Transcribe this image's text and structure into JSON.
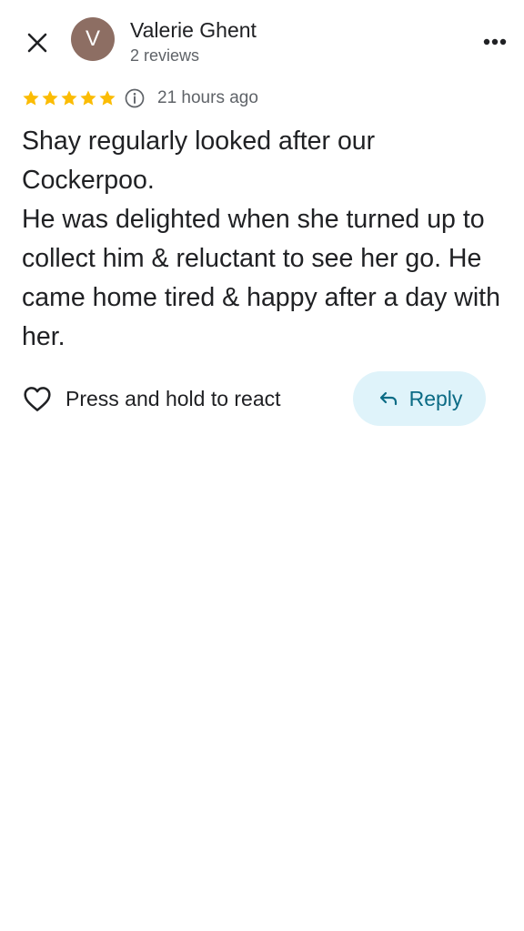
{
  "header": {
    "close_icon": "close-icon",
    "more_icon": "more-horizontal-icon"
  },
  "author": {
    "initial": "V",
    "avatar_color": "#8d6e63",
    "name": "Valerie Ghent",
    "reviews": "2 reviews"
  },
  "review": {
    "rating": 5,
    "max_rating": 5,
    "star_color": "#fbbc04",
    "info_icon": "info-icon",
    "time_ago": "21 hours ago",
    "text": "Shay regularly looked after our Cockerpoo.\nHe was delighted when she turned up to collect him & reluctant to see her go. He came home tired & happy after a day with her."
  },
  "actions": {
    "react_icon": "heart-outline-icon",
    "react_label": "Press and hold to react",
    "reply_icon": "reply-arrow-icon",
    "reply_label": "Reply",
    "reply_bg": "#dff3fa",
    "reply_text_color": "#0b6b85"
  }
}
